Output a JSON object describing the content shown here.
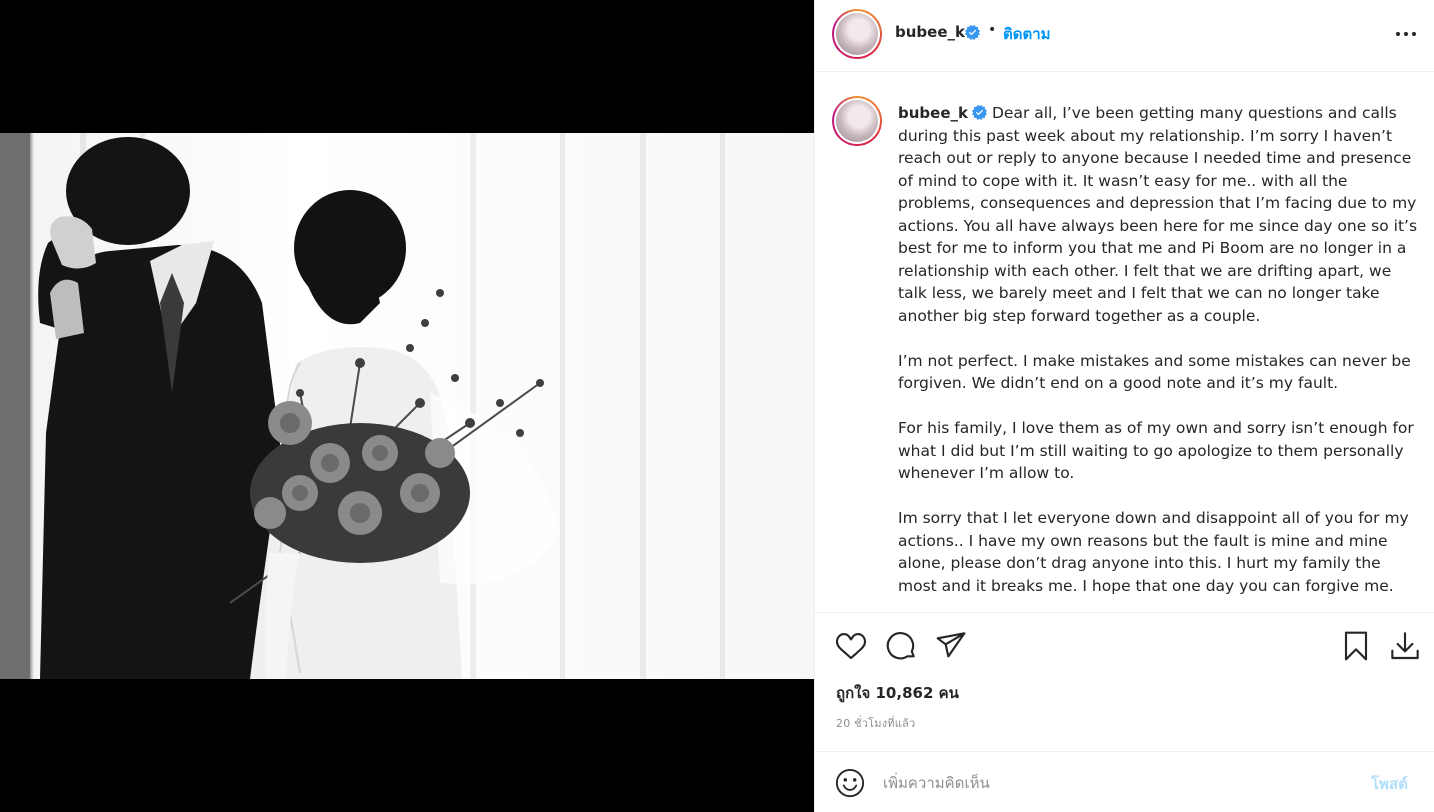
{
  "header": {
    "username": "bubee_k",
    "separator": "•",
    "follow_label": "ติดตาม"
  },
  "caption": {
    "username": "bubee_k",
    "paragraphs": [
      "Dear all, I’ve been getting many questions and calls during this past week about my relationship. I’m sorry I haven’t reach out or reply to anyone because I needed time and presence of mind to cope with it. It wasn’t easy for me.. with all the problems, consequences and depression that I’m facing due to my actions. You all have always been here for me since day one so it’s best for me to inform you that me and Pi Boom are no longer in a relationship with each other. I felt that we are drifting apart, we talk less, we barely meet and I felt that we can no longer take another big step forward together as a couple.",
      "I’m not perfect. I make mistakes and some mistakes can never be forgiven. We didn’t end on a good note and it’s my fault.",
      "For his family, I love them as of my own and sorry isn’t enough for what I did but I’m still waiting to go apologize to them personally whenever I’m allow to.",
      "Im sorry that I let everyone down and disappoint all of you for my actions.. I have my own reasons but the fault is mine and mine alone, please don’t drag anyone into this. I hurt my family the most and it breaks me. I hope that one day you can forgive me."
    ]
  },
  "stats": {
    "likes_text": "ถูกใจ 10,862 คน",
    "time_ago": "20 ชั่วโมงที่แล้ว"
  },
  "comment": {
    "placeholder": "เพิ่มความคิดเห็น",
    "post_label": "โพสต์"
  },
  "colors": {
    "accent": "#0095f6",
    "post_disabled": "#b2dffc",
    "verified": "#3897f0",
    "text": "#262626",
    "muted": "#8e8e8e"
  }
}
